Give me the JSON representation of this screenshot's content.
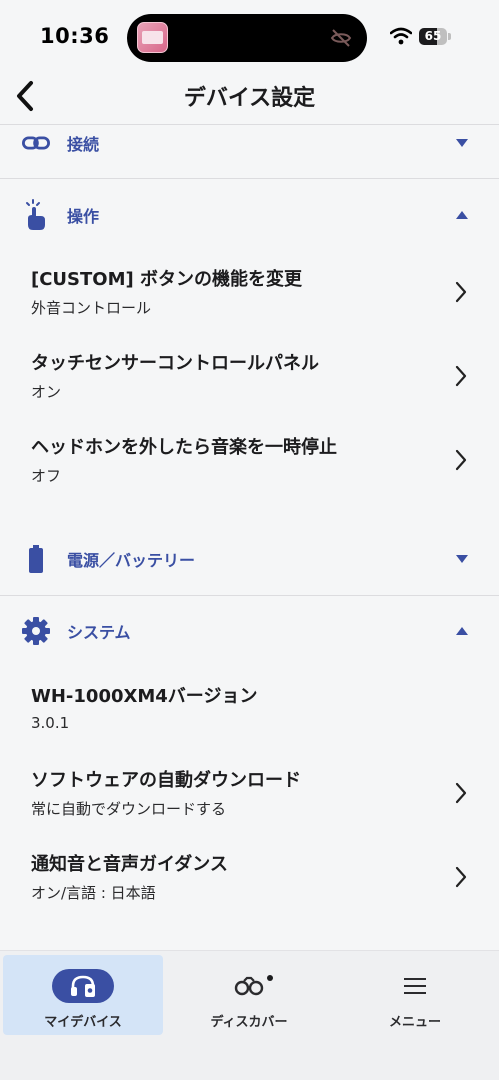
{
  "status_bar": {
    "time": "10:36",
    "battery_level": "65",
    "battery_fraction": 0.65
  },
  "nav": {
    "title": "デバイス設定",
    "back_icon": "chevron-left-icon"
  },
  "sections": {
    "connection": {
      "label": "接続",
      "icon": "link-icon",
      "expanded": false
    },
    "operation": {
      "label": "操作",
      "icon": "touch-hand-icon",
      "expanded": true,
      "items": [
        {
          "title": "[CUSTOM] ボタンの機能を変更",
          "value": "外音コントロール"
        },
        {
          "title": "タッチセンサーコントロールパネル",
          "value": "オン"
        },
        {
          "title": "ヘッドホンを外したら音楽を一時停止",
          "value": "オフ"
        }
      ]
    },
    "power": {
      "label": "電源／バッテリー",
      "icon": "battery-icon",
      "expanded": false
    },
    "system": {
      "label": "システム",
      "icon": "gear-icon",
      "expanded": true,
      "items": [
        {
          "title": "WH-1000XM4バージョン",
          "value": "3.0.1"
        },
        {
          "title": "ソフトウェアの自動ダウンロード",
          "value": "常に自動でダウンロードする"
        },
        {
          "title": "通知音と音声ガイダンス",
          "value": "オン/言語 : 日本語"
        }
      ]
    }
  },
  "tab_bar": {
    "tabs": [
      {
        "label": "マイデバイス",
        "icon": "headphones-icon",
        "active": true
      },
      {
        "label": "ディスカバー",
        "icon": "binoculars-icon",
        "active": false,
        "badge": true
      },
      {
        "label": "メニュー",
        "icon": "hamburger-menu-icon",
        "active": false
      }
    ]
  },
  "colors": {
    "accent": "#3a4fa3",
    "background": "#f5f6f7",
    "active_tab": "#d4e4f7"
  }
}
